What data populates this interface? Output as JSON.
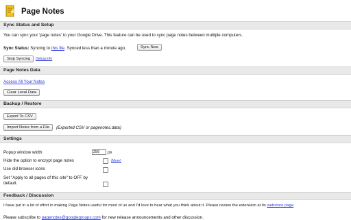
{
  "app": {
    "title": "Page Notes"
  },
  "sections": {
    "sync": {
      "title": "Sync Status and Setup",
      "description": "You can sync your 'page notes' to your Google Drive. This feature can be used to sync page notes between multiple computers.",
      "status_label": "Sync Status:",
      "status_pre": "Syncing to",
      "status_link": "this file",
      "status_post": ". Synced less than a minute ago.",
      "sync_now_label": "Sync Now",
      "stop_label": "Stop Syncing",
      "debug_link": "Debug info"
    },
    "data": {
      "title": "Page Notes Data",
      "access_link": "Access All Your Notes",
      "clear_label": "Clear Local Data"
    },
    "backup": {
      "title": "Backup / Restore",
      "export_label": "Export To CSV",
      "import_label": "Import Notes from a File",
      "import_note": "(Exported CSV or pagenotes.data)"
    },
    "settings": {
      "title": "Settings",
      "popup_width_label": "Popup window width",
      "popup_width_value": "256",
      "popup_width_unit": "px",
      "hide_encrypt_label": "Hide the option to encrypt page notes",
      "more_link": "(More)",
      "old_icons_label": "Use old browser icons",
      "apply_all_label_1": "Set \"Apply to all pages of this site\" to OFF by",
      "apply_all_label_2": "default."
    },
    "feedback": {
      "title": "Feedback / Discussion",
      "text_pre": "I have put in a lot of effort in making Page Notes useful for most of us and I'd love to hear what you think about it. Please review the extension at its",
      "store_link": "webstore page",
      "text_post": ".",
      "subscribe_pre": "Please subscribe to",
      "subscribe_link": "pagenotes@googlegroups.com",
      "subscribe_post": "for new release announcements and other discussion."
    }
  },
  "colors": {
    "link": "#2a3bd6",
    "section_bg": "#e9e9e9",
    "logo_yellow": "#f2c319"
  }
}
